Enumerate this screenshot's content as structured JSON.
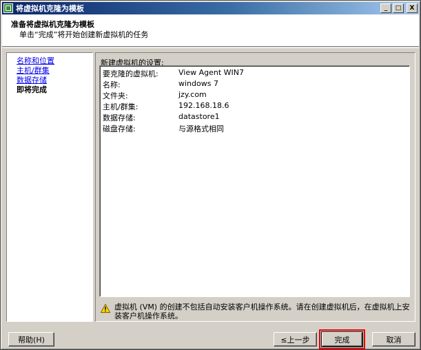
{
  "window": {
    "title": "将虚拟机克隆为模板",
    "controls": {
      "minimize": "_",
      "maximize": "□",
      "close": "X"
    }
  },
  "header": {
    "title": "准备将虚拟机克隆为模板",
    "subtitle": "单击“完成”将开始创建新虚拟机的任务"
  },
  "nav": {
    "items": [
      {
        "label": "名称和位置",
        "state": "link"
      },
      {
        "label": "主机/群集",
        "state": "link"
      },
      {
        "label": "数据存储",
        "state": "link"
      },
      {
        "label": "即将完成",
        "state": "current"
      }
    ]
  },
  "settings": {
    "heading": "新建虚拟机的设置:",
    "rows": [
      {
        "key": "要克隆的虚拟机:",
        "value": "View Agent WIN7"
      },
      {
        "key": "名称:",
        "value": "windows 7"
      },
      {
        "key": "文件夹:",
        "value": "jzy.com"
      },
      {
        "key": "主机/群集:",
        "value": "192.168.18.6"
      },
      {
        "key": "数据存储:",
        "value": "datastore1"
      },
      {
        "key": "磁盘存储:",
        "value": "与源格式相同"
      }
    ]
  },
  "notice": {
    "icon": "warning-icon",
    "text": "虚拟机 (VM) 的创建不包括自动安装客户机操作系统。请在创建虚拟机后，在虚拟机上安装客户机操作系统。"
  },
  "buttons": {
    "help": "帮助(H)",
    "back": "≤上一步",
    "finish": "完成",
    "cancel": "取消"
  },
  "colors": {
    "titlebar": "#0a246a",
    "link": "#0000ee",
    "highlight": "#e60000",
    "face": "#d4d0c8"
  }
}
